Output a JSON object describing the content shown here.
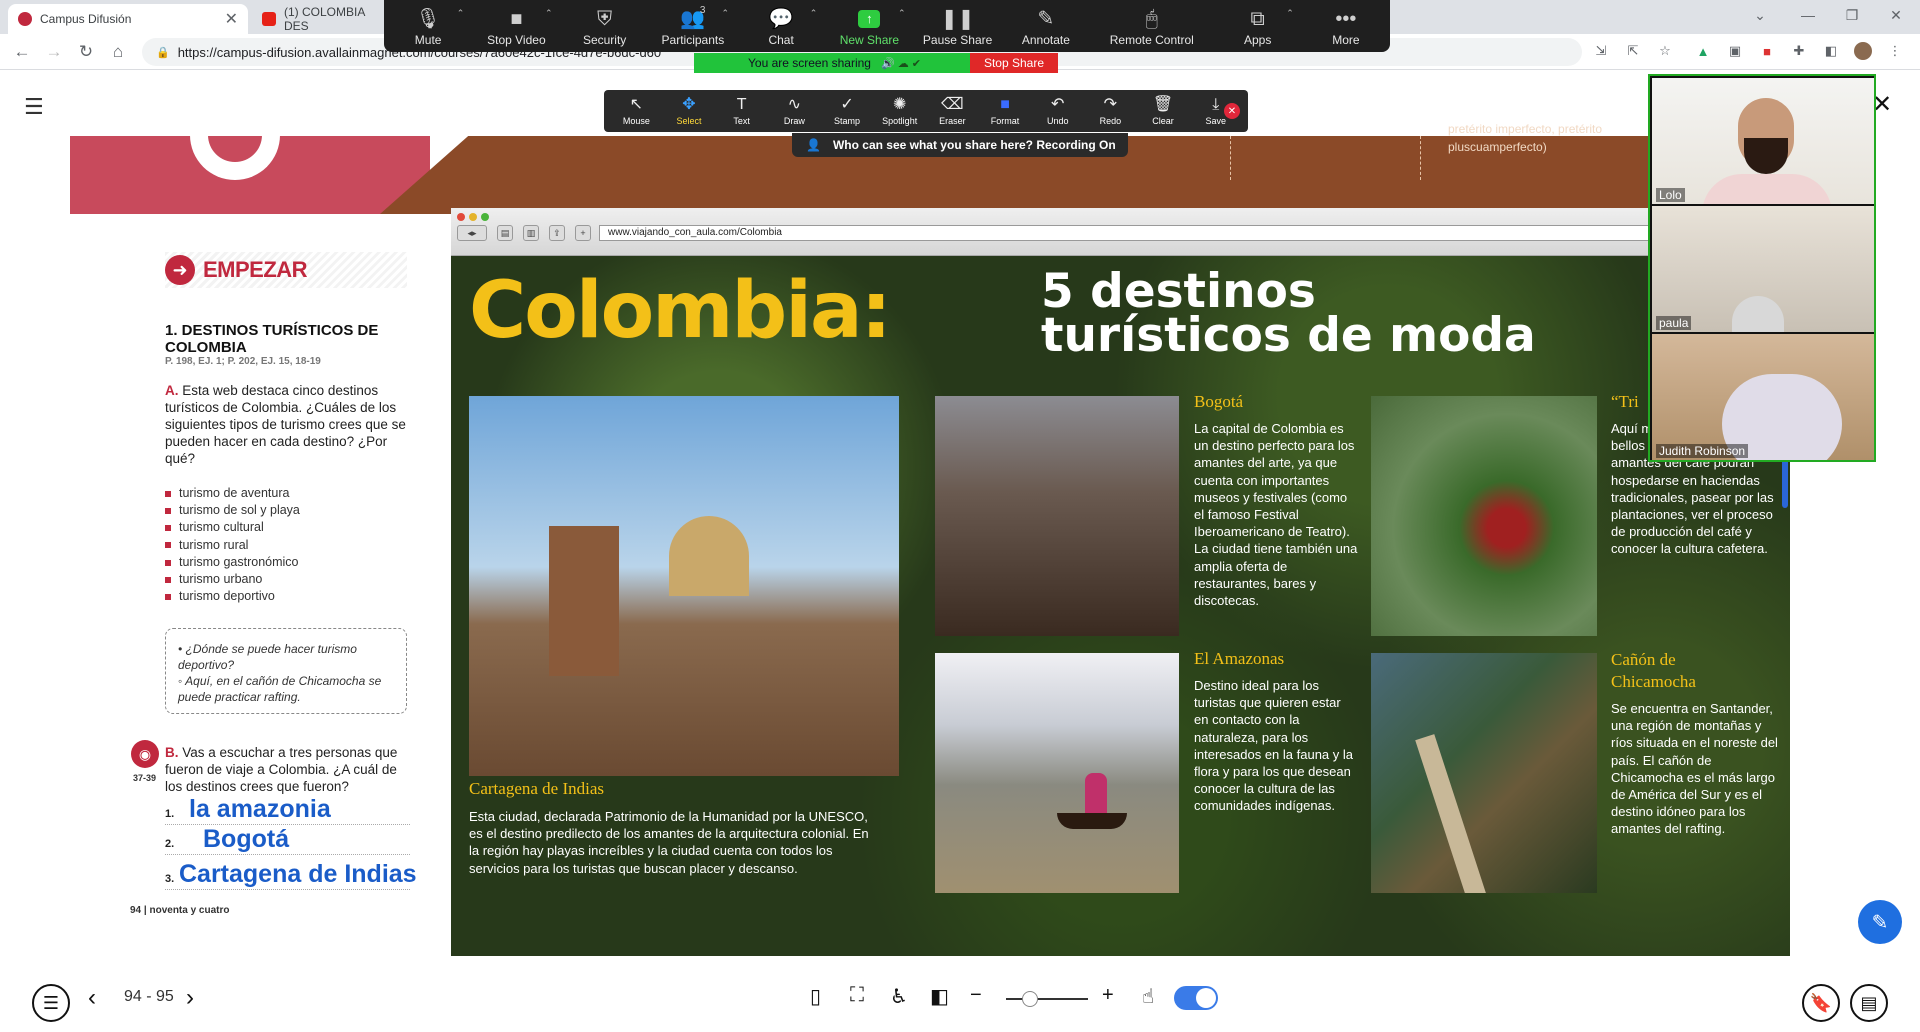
{
  "browser": {
    "tabs": [
      {
        "title": "Campus Difusión",
        "active": true
      },
      {
        "title": "(1) COLOMBIA DES",
        "active": false
      }
    ],
    "url": "https://campus-difusion.avallainmagnet.com/courses/7a60e42c-1fce-4d7e-b6dc-d60",
    "tab_close": "✕"
  },
  "zoom": {
    "toolbar": [
      {
        "label": "Mute",
        "icon": "mic-icon"
      },
      {
        "label": "Stop Video",
        "icon": "video-icon"
      },
      {
        "label": "Security",
        "icon": "shield-icon"
      },
      {
        "label": "Participants",
        "icon": "people-icon",
        "count": "3"
      },
      {
        "label": "Chat",
        "icon": "chat-icon"
      },
      {
        "label": "New Share",
        "icon": "share-icon"
      },
      {
        "label": "Pause Share",
        "icon": "pause-icon"
      },
      {
        "label": "Annotate",
        "icon": "pencil-icon"
      },
      {
        "label": "Remote Control",
        "icon": "mouse-icon"
      },
      {
        "label": "Apps",
        "icon": "apps-icon"
      },
      {
        "label": "More",
        "icon": "more-icon"
      }
    ],
    "sharing_text": "You are screen sharing",
    "stop_share": "Stop Share",
    "annotate_tools": [
      "Mouse",
      "Select",
      "Text",
      "Draw",
      "Stamp",
      "Spotlight",
      "Eraser",
      "Format",
      "Undo",
      "Redo",
      "Clear",
      "Save"
    ],
    "recording_notice": "Who can see what you share here? Recording On",
    "participants": [
      {
        "name": "Lolo"
      },
      {
        "name": "paula"
      },
      {
        "name": "Judith Robinson"
      }
    ]
  },
  "book": {
    "band_text": "pretérito imperfecto, pretérito pluscuamperfecto)",
    "section": "EMPEZAR",
    "exercise_title": "1.  DESTINOS TURÍSTICOS DE COLOMBIA",
    "exercise_ref": "P. 198, EJ. 1; P. 202, EJ. 15, 18-19",
    "part_a_letter": "A.",
    "part_a_text": "Esta web destaca cinco destinos turísticos de Colombia. ¿Cuáles de los siguientes tipos de turismo crees que se pueden hacer en cada destino? ¿Por qué?",
    "tourism_types": [
      "turismo de aventura",
      "turismo de sol y playa",
      "turismo cultural",
      "turismo rural",
      "turismo gastronómico",
      "turismo urbano",
      "turismo deportivo"
    ],
    "bubble_q": "¿Dónde se puede hacer turismo deportivo?",
    "bubble_a": "Aquí, en el cañón de Chicamocha se puede practicar rafting.",
    "audio_tracks": "37-39",
    "part_b_letter": "B.",
    "part_b_text": "Vas a escuchar a tres personas que fueron de viaje a Colombia. ¿A cuál de los destinos crees que fueron?",
    "answers": [
      {
        "n": "1.",
        "v": "la amazonia"
      },
      {
        "n": "2.",
        "v": "Bogotá"
      },
      {
        "n": "3.",
        "v": "Cartagena de Indias"
      }
    ],
    "page_footer": "94 | noventa y cuatro"
  },
  "website": {
    "url": "www.viajando_con_aula.com/Colombia",
    "title": "Colombia:",
    "subtitle_1": "5 destinos",
    "subtitle_2": "turísticos de moda",
    "destinations": [
      {
        "name": "Cartagena de Indias",
        "text": "Esta ciudad, declarada Patrimonio de la Humanidad por la UNESCO, es el destino predilecto de los amantes de la arquitectura colonial. En la región hay playas increíbles y la ciudad cuenta con todos los servicios para los turistas que buscan placer y descanso."
      },
      {
        "name": "Bogotá",
        "text": "La capital de Colombia es un destino perfecto para los amantes del arte, ya que cuenta con importantes museos y festivales (como el famoso Festival Iberoamericano de Teatro). La ciudad tiene también una amplia oferta de restaurantes, bares y discotecas."
      },
      {
        "name": "“Tri",
        "text": "Aquí mejor Un lugar con bellos paisajes, en el que los amantes del café podrán hospedarse en haciendas tradicionales, pasear por las plantaciones, ver el proceso de producción del café y conocer la cultura cafetera."
      },
      {
        "name": "El Amazonas",
        "text": "Destino ideal para los turistas que quieren estar en contacto con la naturaleza, para los interesados en la fauna y la flora y para los que desean conocer la cultura de las comunidades indígenas."
      },
      {
        "name": "Cañón de Chicamocha",
        "text": "Se encuentra en Santander, una región de montañas y ríos situada en el noreste del país. El cañón de Chicamocha es el más largo de América del Sur y es el destino idóneo para los amantes del rafting."
      }
    ]
  },
  "reader": {
    "pages": "94 - 95"
  }
}
